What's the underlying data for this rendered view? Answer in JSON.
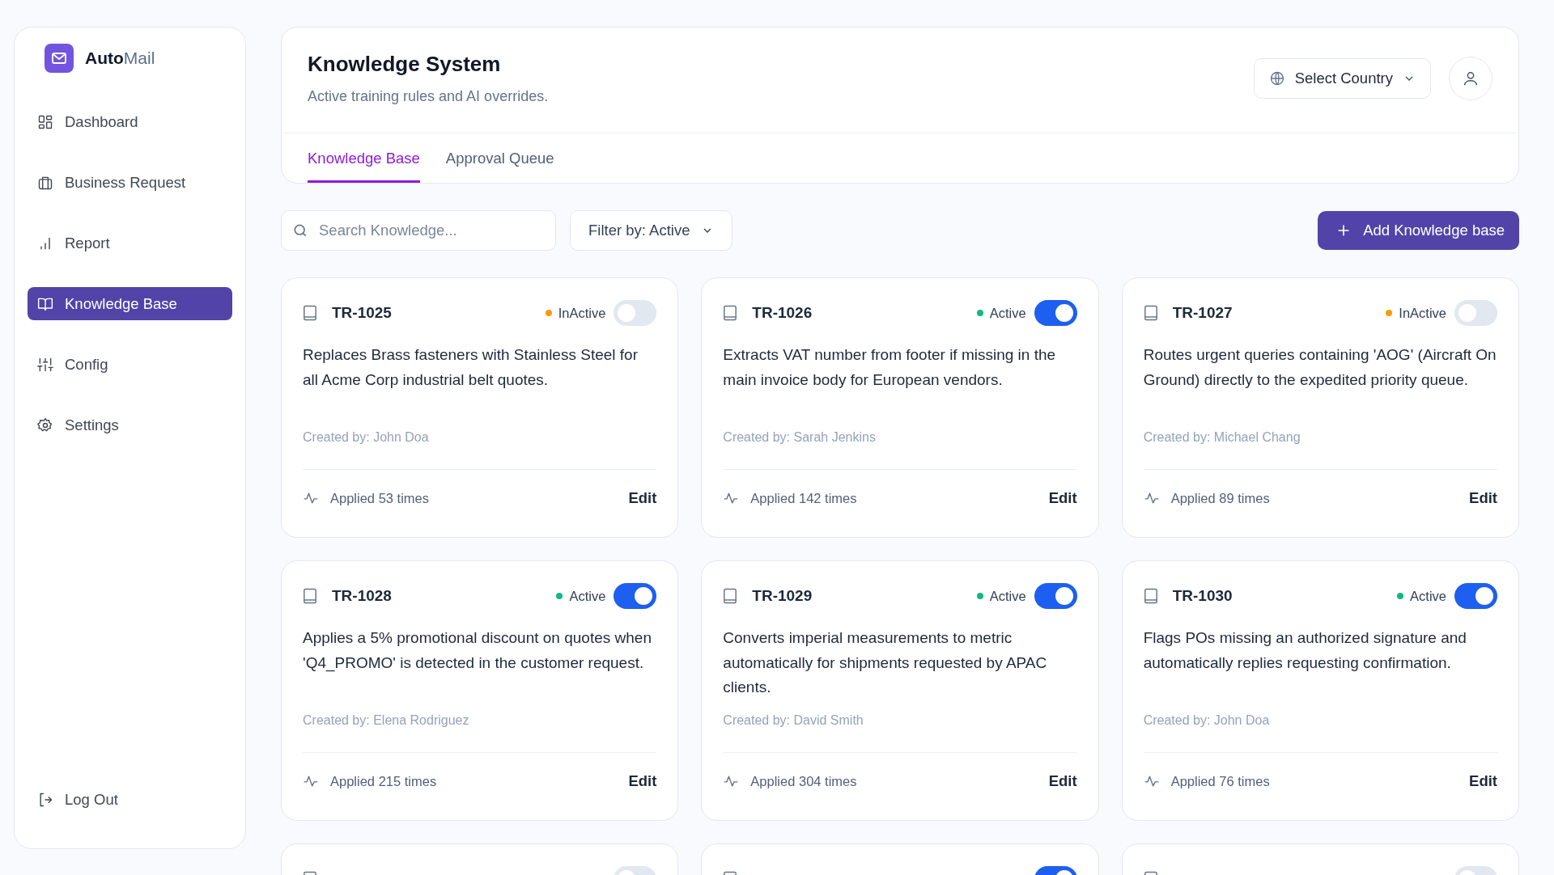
{
  "brand": {
    "bold": "Auto",
    "light": "Mail"
  },
  "sidebar": {
    "items": [
      {
        "label": "Dashboard",
        "kind": "grid",
        "selected": false
      },
      {
        "label": "Business Request",
        "kind": "briefcase",
        "selected": false
      },
      {
        "label": "Report",
        "kind": "bars",
        "selected": false
      },
      {
        "label": "Knowledge Base",
        "kind": "book",
        "selected": true
      },
      {
        "label": "Config",
        "kind": "sliders",
        "selected": false
      },
      {
        "label": "Settings",
        "kind": "gear",
        "selected": false
      }
    ],
    "logout": "Log Out"
  },
  "header": {
    "title": "Knowledge System",
    "subtitle": "Active training rules and AI overrides.",
    "country_select": "Select Country"
  },
  "tabs": [
    {
      "label": "Knowledge Base",
      "selected": true
    },
    {
      "label": "Approval Queue",
      "selected": false
    }
  ],
  "search": {
    "placeholder": "Search Knowledge..."
  },
  "filter": "Filter by: Active",
  "add_button": "Add Knowledge base",
  "cards": [
    {
      "id": "TR-1025",
      "status": "InActive",
      "color": "#f59e0b",
      "on": false,
      "description": "Replaces Brass fasteners with Stainless Steel for all Acme Corp industrial belt quotes.",
      "created_by": "Created by: John Doa",
      "applied": "Applied 53 times",
      "edit": "Edit"
    },
    {
      "id": "TR-1026",
      "status": "Active",
      "color": "#10b981",
      "on": true,
      "description": "Extracts VAT number from footer if missing in the main invoice body for European vendors.",
      "created_by": "Created by: Sarah Jenkins",
      "applied": "Applied 142 times",
      "edit": "Edit"
    },
    {
      "id": "TR-1027",
      "status": "InActive",
      "color": "#f59e0b",
      "on": false,
      "description": "Routes urgent queries containing 'AOG' (Aircraft On Ground) directly to the expedited priority queue.",
      "created_by": "Created by: Michael Chang",
      "applied": "Applied 89 times",
      "edit": "Edit"
    },
    {
      "id": "TR-1028",
      "status": "Active",
      "color": "#10b981",
      "on": true,
      "description": "Applies a 5% promotional discount on quotes when 'Q4_PROMO' is detected in the customer request.",
      "created_by": "Created by: Elena Rodriguez",
      "applied": "Applied 215 times",
      "edit": "Edit"
    },
    {
      "id": "TR-1029",
      "status": "Active",
      "color": "#10b981",
      "on": true,
      "description": "Converts imperial measurements to metric automatically for shipments requested by APAC clients.",
      "created_by": "Created by: David Smith",
      "applied": "Applied 304 times",
      "edit": "Edit"
    },
    {
      "id": "TR-1030",
      "status": "Active",
      "color": "#10b981",
      "on": true,
      "description": "Flags POs missing an authorized signature and automatically replies requesting confirmation.",
      "created_by": "Created by: John Doa",
      "applied": "Applied 76 times",
      "edit": "Edit"
    },
    {
      "on": false
    },
    {
      "on": true
    },
    {
      "on": false
    }
  ]
}
